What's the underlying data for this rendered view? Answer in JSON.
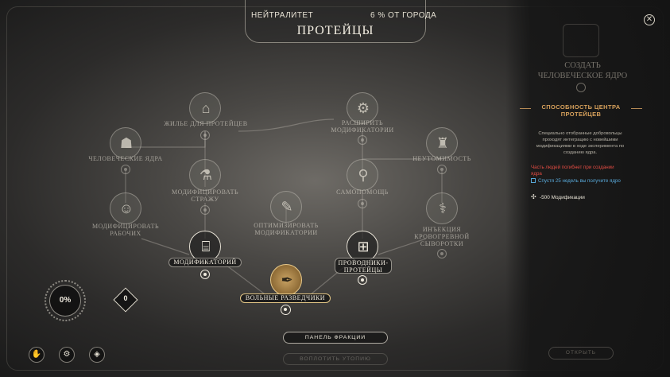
{
  "header": {
    "neutrality_label": "НЕЙТРАЛИТЕТ",
    "neutrality_value": "6 % ОТ ГОРОДА",
    "faction_title": "ПРОТЕЙЦЫ"
  },
  "tree": {
    "nodes": [
      {
        "id": "housing",
        "label_lines": [
          "ЖИЛЬЕ ДЛЯ ПРОТЕЙЦЕВ"
        ],
        "icon": "housing-icon"
      },
      {
        "id": "expand",
        "label_lines": [
          "РАСШИРИТЬ",
          "МОДИФИКАТОРИИ"
        ],
        "icon": "expand-icon"
      },
      {
        "id": "human_cores",
        "label_lines": [
          "ЧЕЛОВЕЧЕСКИЕ ЯДРА"
        ],
        "icon": "human-core-icon"
      },
      {
        "id": "tireless",
        "label_lines": [
          "НЕУТОМИМОСТЬ"
        ],
        "icon": "tireless-icon"
      },
      {
        "id": "modify_guard",
        "label_lines": [
          "МОДИФИЦИРОВАТЬ",
          "СТРАЖУ"
        ],
        "icon": "guard-icon"
      },
      {
        "id": "self_help",
        "label_lines": [
          "САМОПОМОЩЬ"
        ],
        "icon": "self-help-icon"
      },
      {
        "id": "modify_workers",
        "label_lines": [
          "МОДИФИЦИРОВАТЬ",
          "РАБОЧИХ"
        ],
        "icon": "workers-icon"
      },
      {
        "id": "optimize",
        "label_lines": [
          "ОПТИМИЗИРОВАТЬ",
          "МОДИФИКАТОРИИ"
        ],
        "icon": "optimize-icon"
      },
      {
        "id": "injection",
        "label_lines": [
          "ИНЪЕКЦИЯ",
          "КРОВОГРЕВНОЙ",
          "СЫВОРОТКИ"
        ],
        "icon": "injection-icon"
      },
      {
        "id": "modificatorium",
        "label": "МОДИФИКАТОРИЙ",
        "icon": "modificatorium-icon"
      },
      {
        "id": "conductors",
        "label_lines": [
          "ПРОВОДНИКИ-",
          "ПРОТЕЙЦЫ"
        ],
        "icon": "conductor-icon"
      },
      {
        "id": "free_scouts",
        "label": "ВОЛЬНЫЕ РАЗВЕДЧИКИ",
        "icon": "scout-icon"
      }
    ]
  },
  "buttons": {
    "faction_panel": "ПАНЕЛЬ ФРАКЦИИ",
    "build_utopia": "ВОПЛОТИТЬ УТОПИЮ",
    "open": "ОТКРЫТЬ"
  },
  "hud": {
    "progress_value": "0%",
    "diamond_value": "0"
  },
  "right_panel": {
    "title_lines": [
      "СОЗДАТЬ",
      "ЧЕЛОВЕЧЕСКОЕ ЯДРО"
    ],
    "ability_lines": [
      "СПОСОБНОСТЬ ЦЕНТРА",
      "ПРОТЕЙЦЕВ"
    ],
    "description_lines": [
      "Специально отобранные добровольцы",
      "проходят интеграцию с новейшими",
      "модификациями в ходе эксперимента по",
      "созданию ядра."
    ],
    "warning_lines": [
      "Часть людей погибнет при создании",
      "ядра"
    ],
    "info_text": "Спустя 25 недель вы получите ядро",
    "modification_cost": "-500 Модификации",
    "colors": {
      "warning": "#e04b42",
      "info": "#58a8d8",
      "ability": "#d6a05b"
    }
  }
}
